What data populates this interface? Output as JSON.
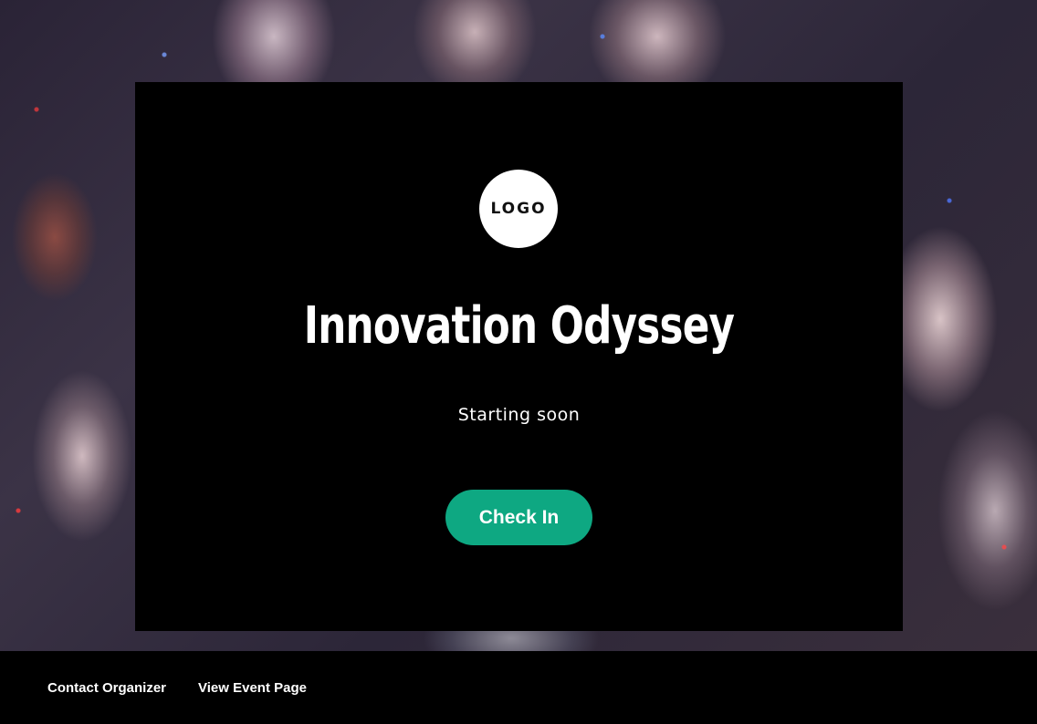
{
  "event": {
    "logo_text": "LOGO",
    "title": "Innovation Odyssey",
    "status": "Starting soon",
    "check_in_label": "Check In"
  },
  "footer": {
    "links": [
      {
        "label": "Contact Organizer"
      },
      {
        "label": "View Event Page"
      }
    ]
  },
  "colors": {
    "accent": "#0ea882",
    "background": "#000000",
    "text": "#ffffff"
  }
}
